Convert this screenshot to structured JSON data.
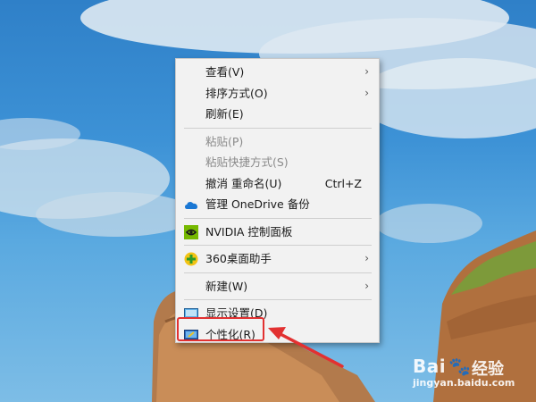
{
  "menu": {
    "items": [
      {
        "label": "查看(V)",
        "has_submenu": true,
        "enabled": true
      },
      {
        "label": "排序方式(O)",
        "has_submenu": true,
        "enabled": true
      },
      {
        "label": "刷新(E)",
        "enabled": true
      },
      {
        "label": "粘贴(P)",
        "enabled": false
      },
      {
        "label": "粘贴快捷方式(S)",
        "enabled": false
      },
      {
        "label": "撤消 重命名(U)",
        "shortcut": "Ctrl+Z",
        "enabled": true
      },
      {
        "label": "管理 OneDrive 备份",
        "icon": "onedrive-cloud-icon",
        "enabled": true
      },
      {
        "label": "NVIDIA 控制面板",
        "icon": "nvidia-icon",
        "enabled": true
      },
      {
        "label": "360桌面助手",
        "icon": "360-assistant-icon",
        "has_submenu": true,
        "enabled": true
      },
      {
        "label": "新建(W)",
        "has_submenu": true,
        "enabled": true
      },
      {
        "label": "显示设置(D)",
        "icon": "display-settings-icon",
        "enabled": true
      },
      {
        "label": "个性化(R)",
        "icon": "personalize-icon",
        "enabled": true,
        "highlighted": true
      }
    ],
    "submenu_glyph": "›"
  },
  "watermark": {
    "logo": "Bai",
    "brand": "经验",
    "url": "jingyan.baidu.com"
  },
  "colors": {
    "highlight": "#e23131",
    "menu_bg": "#f2f2f2",
    "sky": "#3d92d6"
  }
}
